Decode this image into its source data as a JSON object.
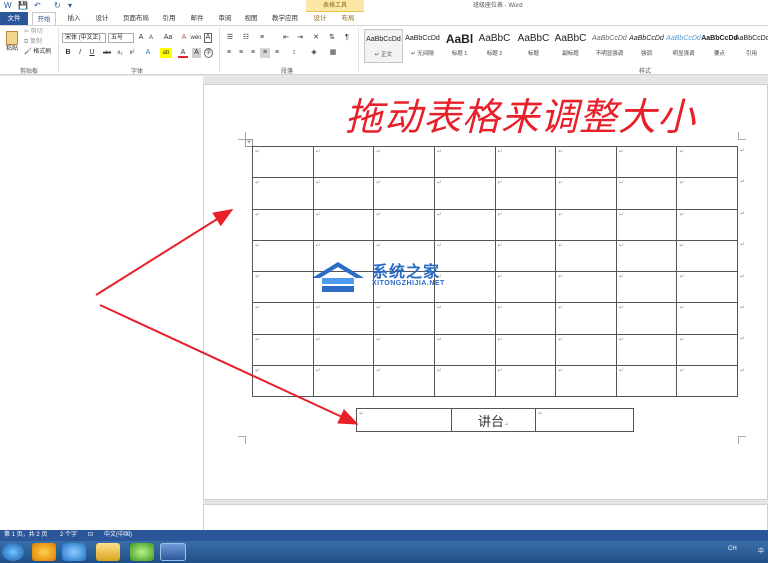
{
  "title_bar": {
    "quick_access": [
      "W",
      "💾",
      "↶",
      "↻",
      "▾"
    ],
    "context_tab": "表格工具",
    "doc_title": "班级座位表 - Word"
  },
  "tabs": {
    "file": "文件",
    "items": [
      "开始",
      "插入",
      "设计",
      "页面布局",
      "引用",
      "邮件",
      "审阅",
      "视图",
      "教学应用",
      "设计",
      "布局"
    ],
    "active_index": 0
  },
  "ribbon": {
    "clipboard": {
      "paste": "粘贴",
      "cut": "剪切",
      "copy": "复制",
      "format_painter": "格式刷",
      "label": "剪贴板"
    },
    "font": {
      "font_name": "宋体 (中文正)",
      "font_size": "五号",
      "grow": "A",
      "shrink": "A",
      "case": "Aa",
      "clear": "A",
      "pinyin": "wén",
      "border_char": "A",
      "bold": "B",
      "italic": "I",
      "underline": "U",
      "strike": "abc",
      "sub": "x₂",
      "sup": "x²",
      "effects": "A",
      "highlight": "ab",
      "color": "A",
      "shade": "A",
      "circle": "字",
      "label": "字体"
    },
    "paragraph": {
      "label": "段落"
    },
    "styles": {
      "label": "样式",
      "items": [
        {
          "preview": "AaBbCcDd",
          "name": "↵ 正文"
        },
        {
          "preview": "AaBbCcDd",
          "name": "↵ 无间隔"
        },
        {
          "preview": "AaBl",
          "name": "标题 1"
        },
        {
          "preview": "AaBbC",
          "name": "标题 2"
        },
        {
          "preview": "AaBbC",
          "name": "标题"
        },
        {
          "preview": "AaBbC",
          "name": "副标题"
        },
        {
          "preview": "AaBbCcDd",
          "name": "不明显强调"
        },
        {
          "preview": "AaBbCcDd",
          "name": "强调"
        },
        {
          "preview": "AaBbCcDd",
          "name": "明显强调"
        },
        {
          "preview": "AaBbCcDd",
          "name": "要点"
        },
        {
          "preview": "AaBbCcDd",
          "name": "引用"
        }
      ]
    }
  },
  "document": {
    "heading": "拖动表格来调整大小",
    "grid_rows": 8,
    "grid_cols": 8,
    "cell_mark": "↵",
    "podium_label": "讲台",
    "watermark_title": "系统之家",
    "watermark_url": "XITONGZHIJIA.NET"
  },
  "status_bar": {
    "page": "第 1 页，共 2 页",
    "words": "2 个字",
    "language": "中文(中国)"
  },
  "taskbar": {
    "tray_ime": "CH",
    "tray_lang": "中"
  },
  "colors": {
    "brand": "#2b579a",
    "arrow": "#e8202a",
    "heading": "#e8202a"
  }
}
